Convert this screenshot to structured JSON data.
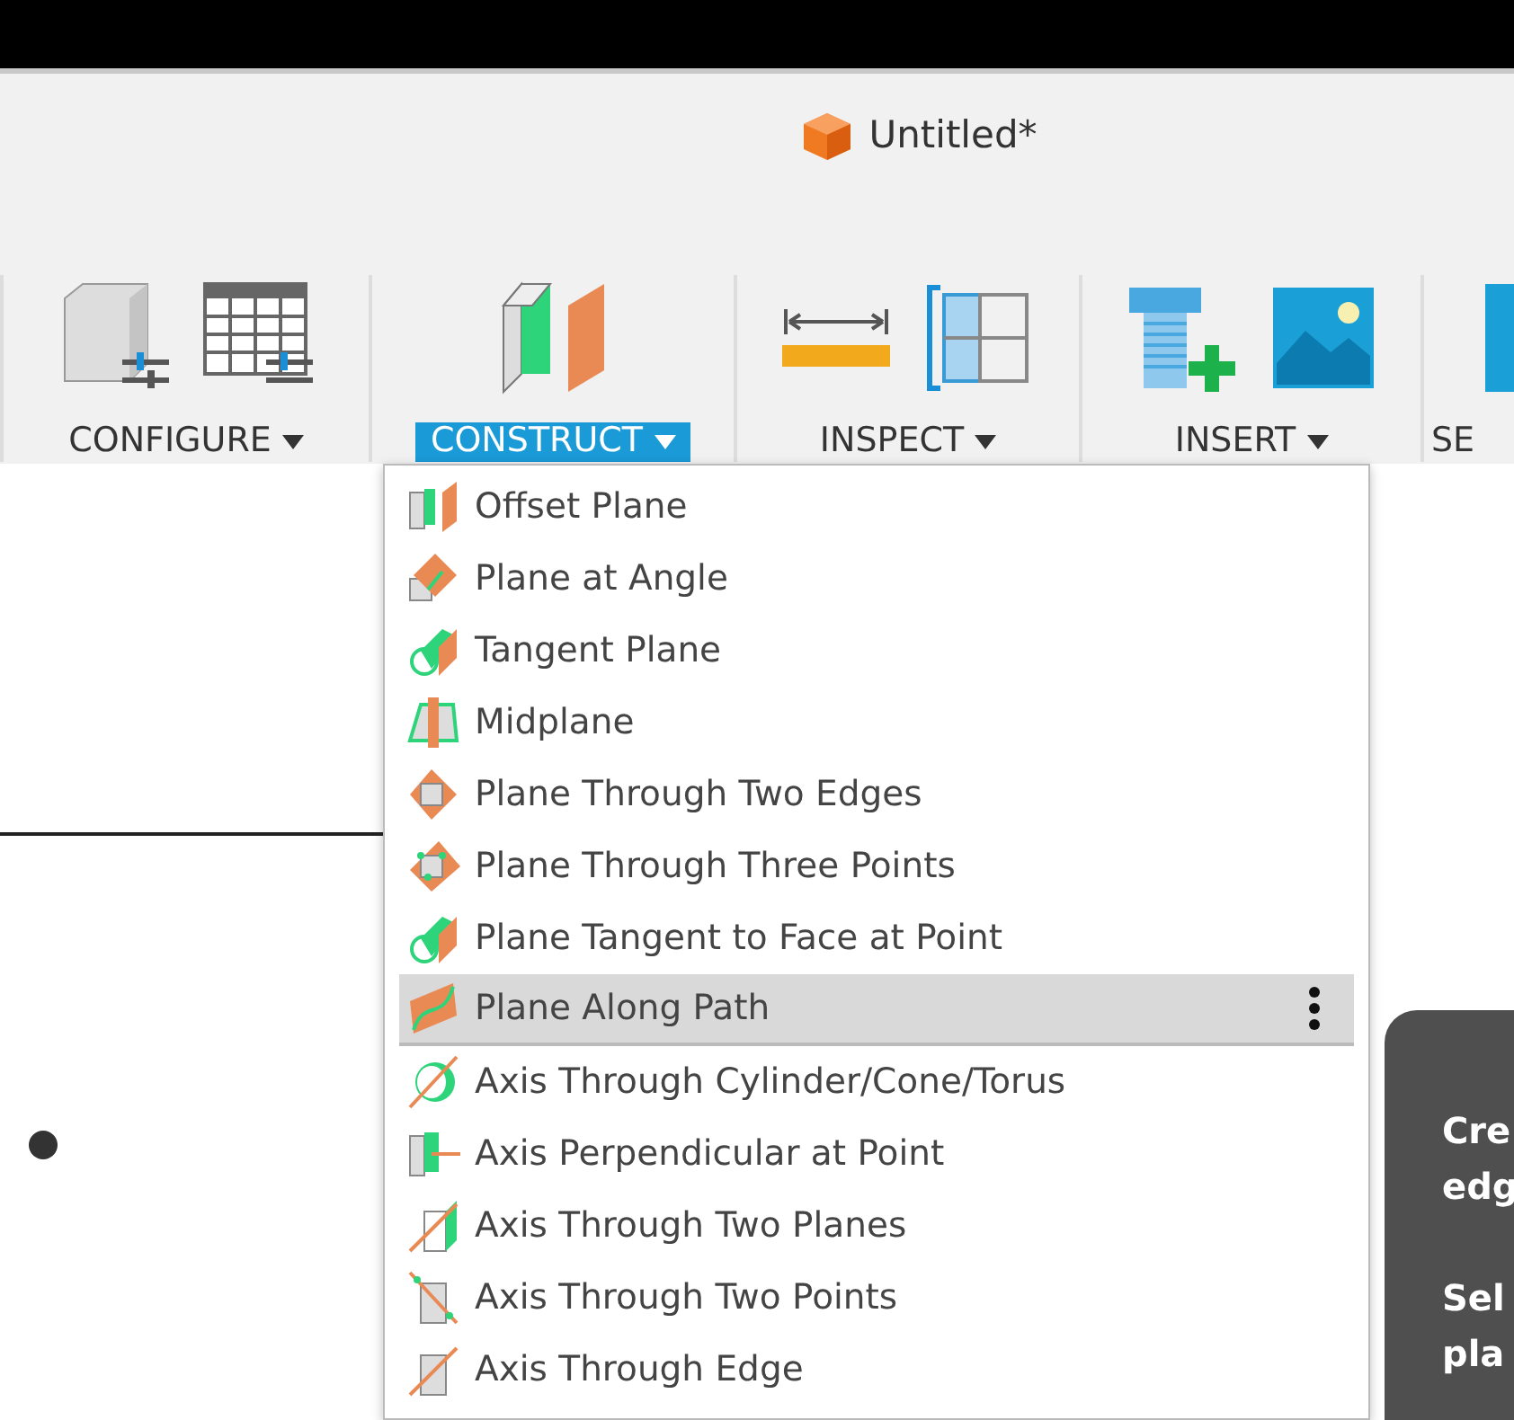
{
  "window": {
    "title": "Untitled*"
  },
  "toolbar": {
    "groups": [
      {
        "label": "CONFIGURE",
        "selected": false
      },
      {
        "label": "CONSTRUCT",
        "selected": true
      },
      {
        "label": "INSPECT",
        "selected": false
      },
      {
        "label": "INSERT",
        "selected": false
      },
      {
        "label": "SE",
        "selected": false
      }
    ]
  },
  "construct_menu": {
    "items": [
      {
        "label": "Offset Plane",
        "selected": false
      },
      {
        "label": "Plane at Angle",
        "selected": false
      },
      {
        "label": "Tangent Plane",
        "selected": false
      },
      {
        "label": "Midplane",
        "selected": false
      },
      {
        "label": "Plane Through Two Edges",
        "selected": false
      },
      {
        "label": "Plane Through Three Points",
        "selected": false
      },
      {
        "label": "Plane Tangent to Face at Point",
        "selected": false
      },
      {
        "label": "Plane Along Path",
        "selected": true
      },
      {
        "label": "Axis Through Cylinder/Cone/Torus",
        "selected": false
      },
      {
        "label": "Axis Perpendicular at Point",
        "selected": false
      },
      {
        "label": "Axis Through Two Planes",
        "selected": false
      },
      {
        "label": "Axis Through Two Points",
        "selected": false
      },
      {
        "label": "Axis Through Edge",
        "selected": false
      }
    ]
  },
  "tooltip": {
    "paragraphs": [
      [
        "Cre",
        "edg"
      ],
      [
        "Sel",
        "pla"
      ]
    ]
  }
}
